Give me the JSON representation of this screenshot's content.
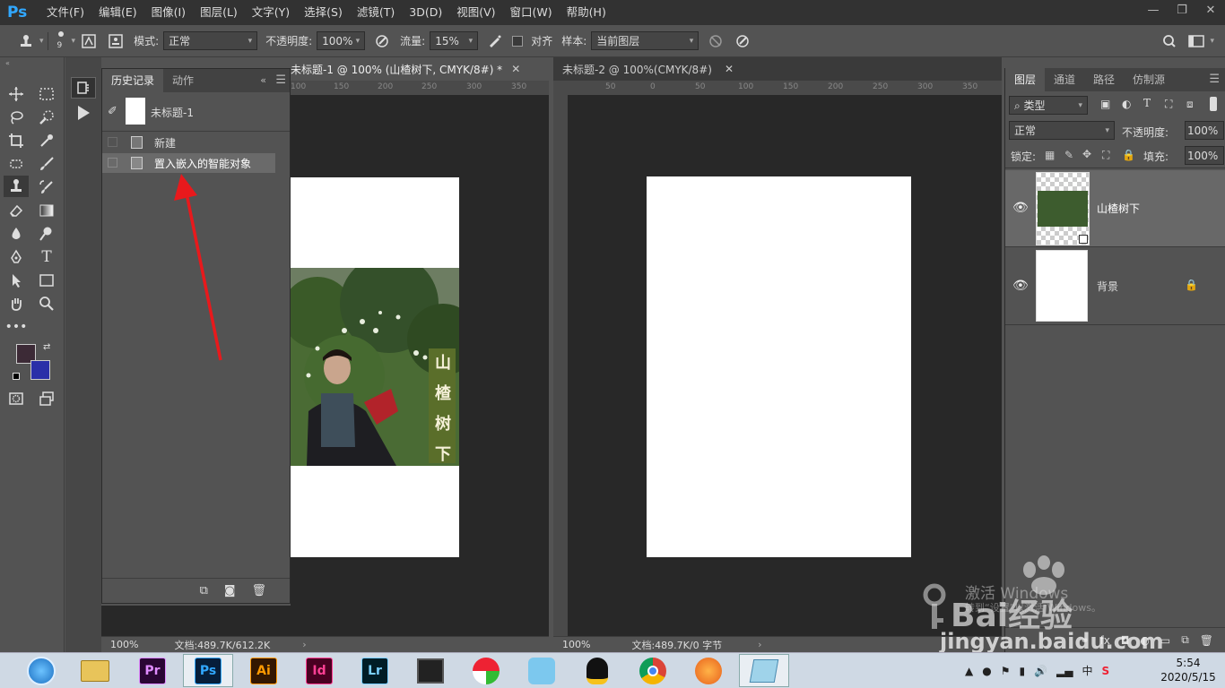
{
  "app": {
    "logo": "Ps"
  },
  "menu": [
    "文件(F)",
    "编辑(E)",
    "图像(I)",
    "图层(L)",
    "文字(Y)",
    "选择(S)",
    "滤镜(T)",
    "3D(D)",
    "视图(V)",
    "窗口(W)",
    "帮助(H)"
  ],
  "options": {
    "brush_size": "9",
    "mode_label": "模式:",
    "mode_value": "正常",
    "opacity_label": "不透明度:",
    "opacity_value": "100%",
    "flow_label": "流量:",
    "flow_value": "15%",
    "align_label": "对齐",
    "sample_label": "样本:",
    "sample_value": "当前图层"
  },
  "history": {
    "tabs": [
      "历史记录",
      "动作"
    ],
    "snapshot": "未标题-1",
    "items": [
      "新建",
      "置入嵌入的智能对象"
    ]
  },
  "doc1": {
    "tab": "未标题-1 @ 100% (山楂树下, CMYK/8#) *",
    "ruler_ticks": [
      "100",
      "150",
      "200",
      "250",
      "300",
      "350"
    ],
    "vertical_text": [
      "山",
      "楂",
      "树",
      "下"
    ],
    "zoom": "100%",
    "doc_info": "文档:489.7K/612.2K"
  },
  "doc2": {
    "tab": "未标题-2 @ 100%(CMYK/8#)",
    "ruler_ticks": [
      "50",
      "0",
      "50",
      "100",
      "150",
      "200",
      "250",
      "300",
      "350"
    ],
    "zoom": "100%",
    "doc_info": "文档:489.7K/0 字节"
  },
  "layers_panel": {
    "tabs": [
      "图层",
      "通道",
      "路径",
      "仿制源"
    ],
    "filter_label": "类型",
    "blend_mode": "正常",
    "opacity_label": "不透明度:",
    "opacity_value": "100%",
    "lock_label": "锁定:",
    "fill_label": "填充:",
    "fill_value": "100%",
    "layers": [
      {
        "name": "山楂树下"
      },
      {
        "name": "背景"
      }
    ]
  },
  "watermark": {
    "text": "激活 Windows",
    "sub": "转到“设置”以激活 Windows。",
    "brand": "Bai经验",
    "url": "jingyan.baidu.com"
  },
  "taskbar": {
    "apps": [
      "Pr",
      "Ps",
      "Ai",
      "Id",
      "Lr"
    ],
    "ime": "中",
    "time": "5:54",
    "date": "2020/5/15"
  },
  "colors": {
    "foreground": "#3c2a36",
    "background": "#2a2fa8",
    "ps_blue": "#31a8ff",
    "arrow": "#e8191c"
  }
}
